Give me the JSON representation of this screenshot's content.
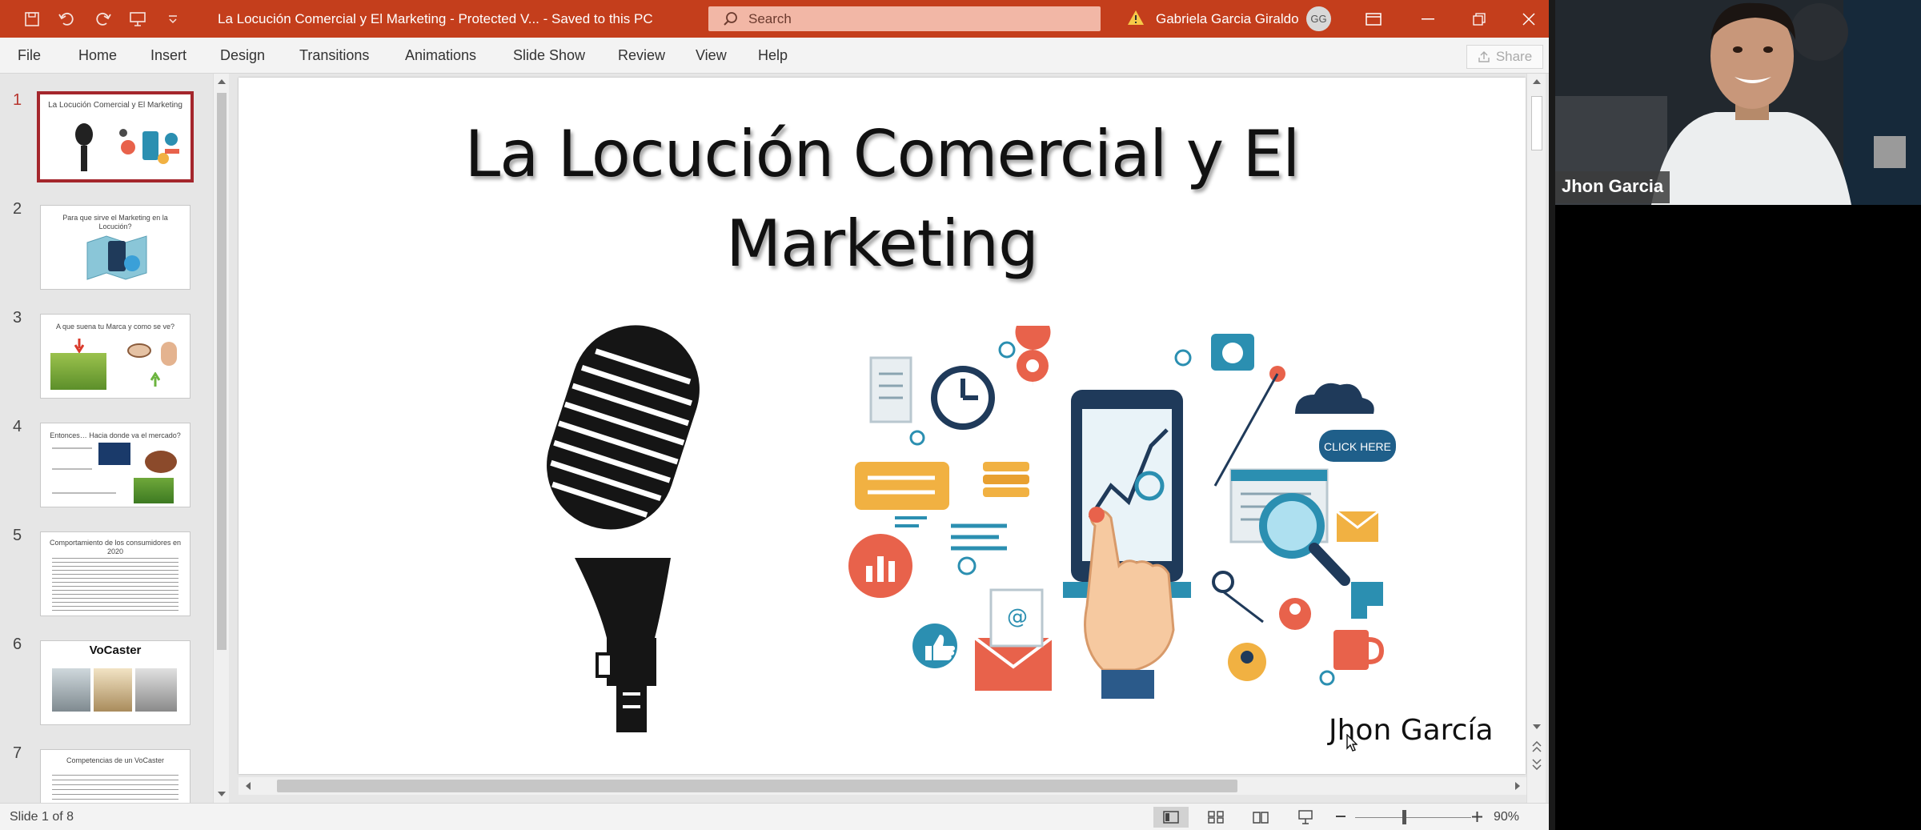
{
  "window": {
    "title": "La Locución Comercial y El Marketing  -  Protected V...  -  Saved to this PC",
    "search_placeholder": "Search",
    "user_name": "Gabriela Garcia Giraldo",
    "user_initials": "GG",
    "accent_color": "#c43e1c"
  },
  "menu": {
    "items": [
      "File",
      "Home",
      "Insert",
      "Design",
      "Transitions",
      "Animations",
      "Slide Show",
      "Review",
      "View",
      "Help"
    ],
    "share_label": "Share"
  },
  "thumbnails": [
    {
      "number": "1",
      "title": "La Locución Comercial y El Marketing",
      "active": true
    },
    {
      "number": "2",
      "title": "Para que sirve el Marketing en la Locución?",
      "active": false
    },
    {
      "number": "3",
      "title": "A que suena tu Marca y como se ve?",
      "active": false
    },
    {
      "number": "4",
      "title": "Entonces… Hacia donde va el mercado?",
      "active": false
    },
    {
      "number": "5",
      "title": "Comportamiento de los consumidores en 2020",
      "active": false
    },
    {
      "number": "6",
      "title": "VoCaster",
      "active": false
    },
    {
      "number": "7",
      "title": "Competencias de un VoCaster",
      "active": false
    }
  ],
  "slide": {
    "title_line1": "La Locución Comercial y El",
    "title_line2": "Marketing",
    "author": "Jhon García",
    "click_here_label": "CLICK HERE"
  },
  "statusbar": {
    "slide_count": "Slide 1 of 8",
    "zoom": "90%"
  },
  "call": {
    "participant_name": "Jhon Garcia"
  }
}
